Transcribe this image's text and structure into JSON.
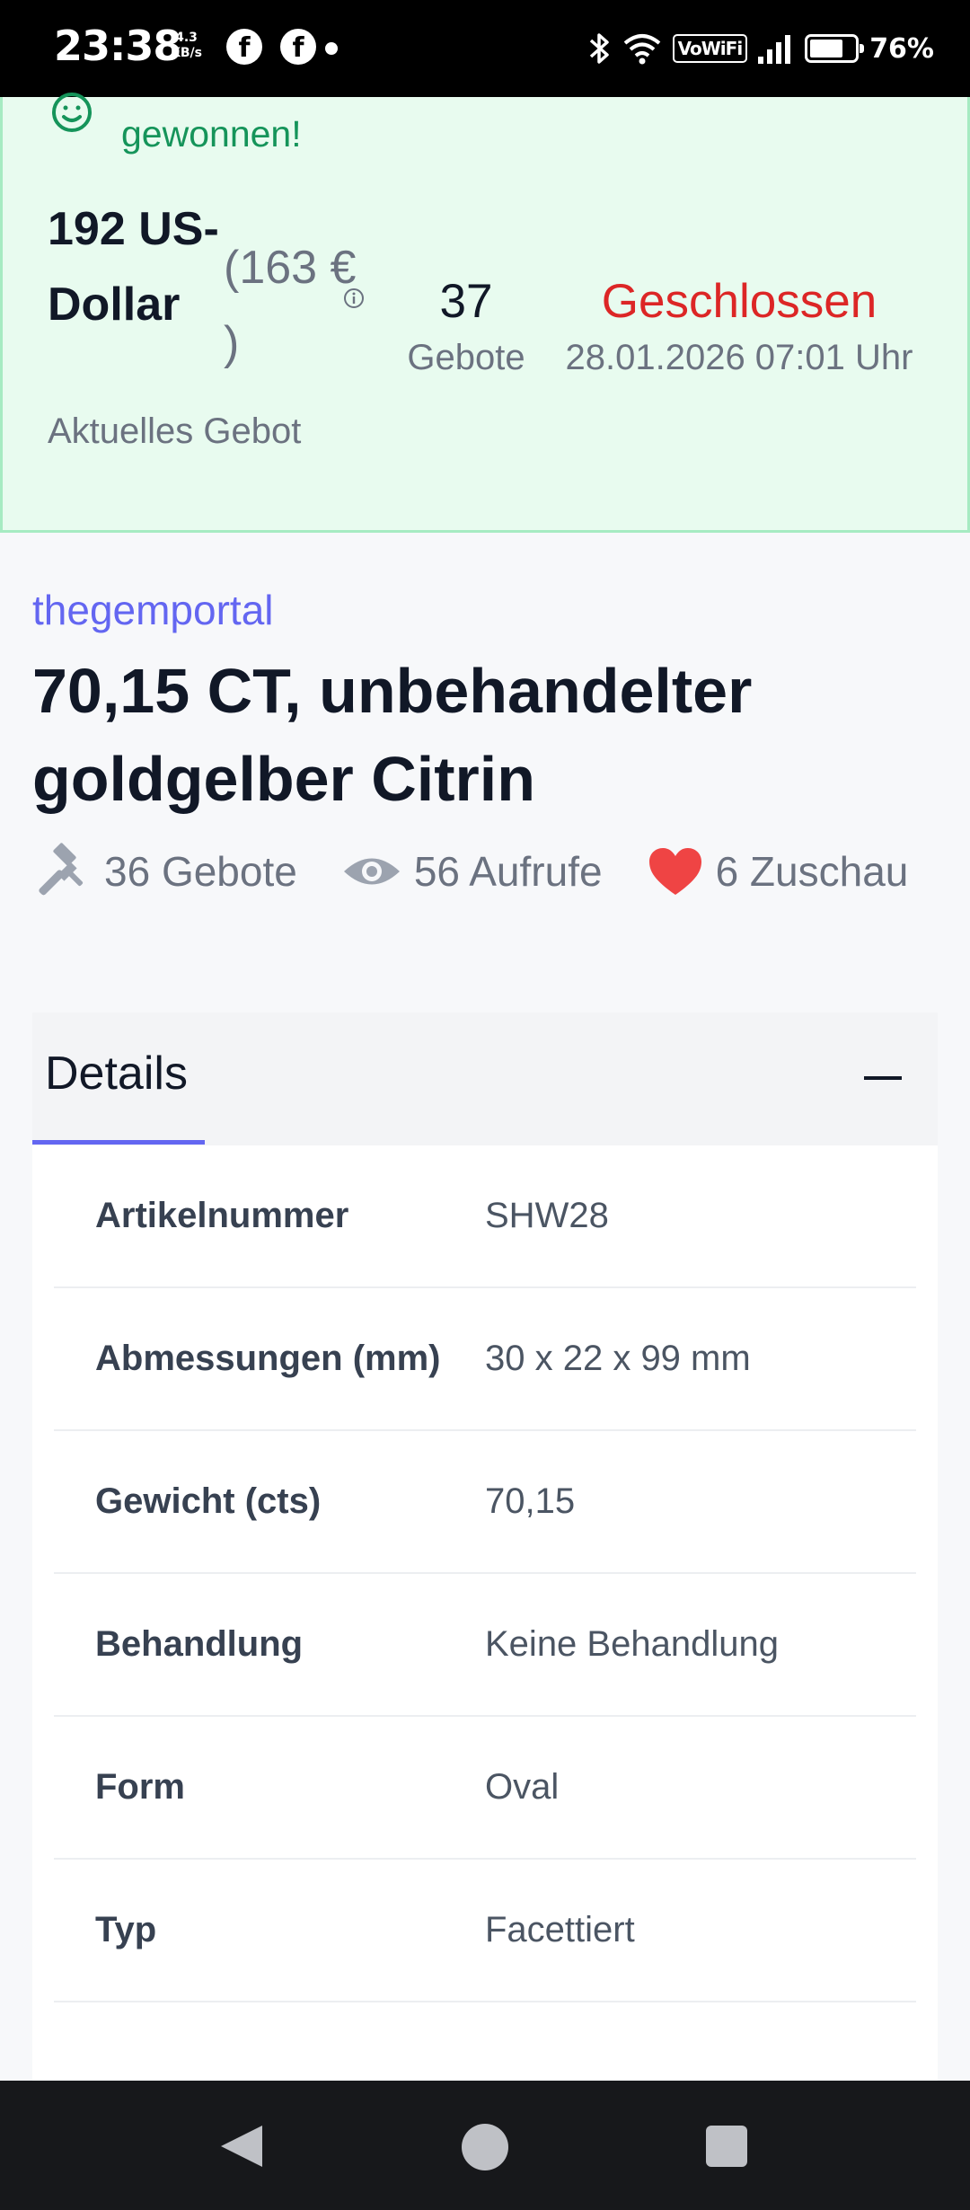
{
  "status_bar": {
    "time": "23:38",
    "speed_value": "4.3",
    "speed_unit": "KB/s",
    "vowifi": "VoWiFi",
    "battery": "76%",
    "battery_level": 0.76
  },
  "banner": {
    "won_text": "gewonnen!",
    "bid_amount": "192 US-Dollar",
    "bid_converted": "(163 € )",
    "bid_label": "Aktuelles Gebot",
    "bid_count": "37",
    "bid_count_label": "Gebote",
    "status": "Geschlossen",
    "closing_date": "28.01.2026 07:01 Uhr"
  },
  "listing": {
    "seller": "thegemportal",
    "title": "70,15 CT, unbehandelter goldgelber Citrin",
    "stats": {
      "bids": "36 Gebote",
      "views": "56 Aufrufe",
      "watchers": "6 Zuschau"
    }
  },
  "details": {
    "heading": "Details",
    "rows": [
      {
        "key": "Artikelnummer",
        "value": "SHW28"
      },
      {
        "key": "Abmessungen (mm)",
        "value": "30 x 22 x 99 mm"
      },
      {
        "key": "Gewicht (cts)",
        "value": "70,15"
      },
      {
        "key": "Behandlung",
        "value": "Keine Behandlung"
      },
      {
        "key": "Form",
        "value": "Oval"
      },
      {
        "key": "Typ",
        "value": "Facettiert"
      }
    ]
  },
  "colors": {
    "accent": "#6366f1",
    "success": "#15945a",
    "danger": "#dc2626",
    "heart": "#ef4444"
  }
}
